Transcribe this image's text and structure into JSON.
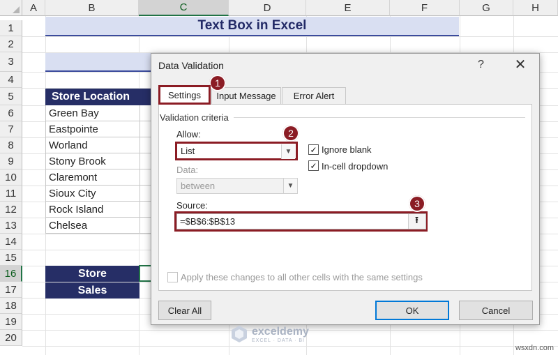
{
  "sheet": {
    "columns": [
      "A",
      "B",
      "C",
      "D",
      "E",
      "F",
      "G",
      "H"
    ],
    "rows": [
      "1",
      "2",
      "3",
      "4",
      "5",
      "6",
      "7",
      "8",
      "9",
      "10",
      "11",
      "12",
      "13",
      "14",
      "15",
      "16",
      "17",
      "18",
      "19",
      "20"
    ],
    "selected_column": "C",
    "selected_row": "16",
    "title": "Text Box in Excel",
    "location_header": "Store Location",
    "locations": [
      "Green Bay",
      "Eastpointe",
      "Worland",
      "Stony Brook",
      "Claremont",
      "Sioux City",
      "Rock Island",
      "Chelsea"
    ],
    "store_label": "Store",
    "sales_label": "Sales"
  },
  "dialog": {
    "title": "Data Validation",
    "help": "?",
    "close": "✕",
    "tabs": [
      "Settings",
      "Input Message",
      "Error Alert"
    ],
    "active_tab": "Settings",
    "group_title": "Validation criteria",
    "allow_label": "Allow:",
    "allow_value": "List",
    "data_label": "Data:",
    "data_value": "between",
    "ignore_blank_label": "Ignore blank",
    "ignore_blank_checked": true,
    "in_cell_dropdown_label": "In-cell dropdown",
    "in_cell_dropdown_checked": true,
    "source_label": "Source:",
    "source_value": "=$B$6:$B$13",
    "apply_all_label": "Apply these changes to all other cells with the same settings",
    "apply_all_checked": false,
    "clear_all_label": "Clear All",
    "ok_label": "OK",
    "cancel_label": "Cancel"
  },
  "callouts": [
    "1",
    "2",
    "3"
  ],
  "watermark": {
    "name": "exceldemy",
    "tagline": "EXCEL · DATA · BI",
    "site": "wsxdn.com"
  },
  "colors": {
    "accent": "#217346",
    "navy": "#262e66",
    "highlight": "#8b1c24",
    "title_band": "#d9dff2",
    "default_button": "#0078d7"
  }
}
